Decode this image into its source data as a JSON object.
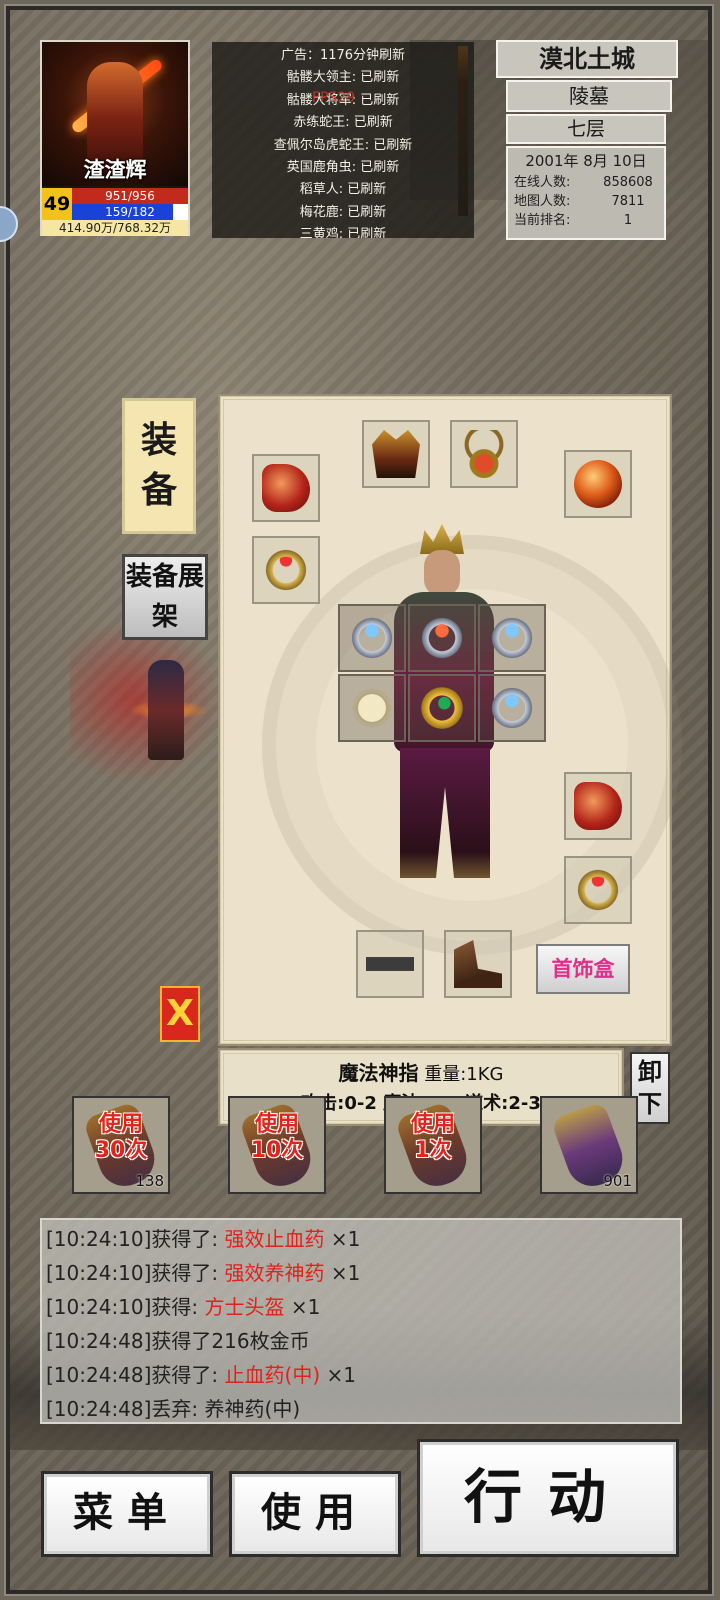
{
  "player": {
    "name": "渣渣辉",
    "level": "49",
    "hp_text": "951/956",
    "mp_text": "159/182",
    "mp_fraction": 0.874,
    "exp_text": "414.90万/768.32万"
  },
  "refresh_list": {
    "fps_overlay": "FPS29",
    "rows": [
      "广告：1176分钟刷新",
      "骷髅大领主: 已刷新",
      "骷髅大将军: 已刷新",
      "赤练蛇王: 已刷新",
      "查佩尔岛虎蛇王: 已刷新",
      "英国鹿角虫: 已刷新",
      "稻草人: 已刷新",
      "梅花鹿: 已刷新",
      "三黄鸡: 已刷新"
    ]
  },
  "location": {
    "city": "漠北土城",
    "map": "陵墓",
    "floor": "七层",
    "date": "2001年 8月 10日",
    "online_label": "在线人数:",
    "online_value": "858608",
    "map_label": "地图人数:",
    "map_value": "7811",
    "rank_label": "当前排名:",
    "rank_value": "1"
  },
  "tabs": {
    "equip_char1": "装",
    "equip_char2": "备",
    "showcase_c1": "装",
    "showcase_c2": "备",
    "showcase_c3": "展",
    "showcase_c4": "架"
  },
  "equipment": {
    "jewelry_box_label": "首饰盒",
    "close_label": "X",
    "slots": [
      {
        "slot": "left-bracelet",
        "icon": "bracelet-icon"
      },
      {
        "slot": "left-ring",
        "icon": "ring-icon"
      },
      {
        "slot": "helmet",
        "icon": "helmet-icon"
      },
      {
        "slot": "necklace",
        "icon": "necklace-icon"
      },
      {
        "slot": "medal",
        "icon": "orb-icon"
      },
      {
        "slot": "right-bracelet",
        "icon": "bracelet-icon"
      },
      {
        "slot": "right-ring",
        "icon": "ring-icon"
      },
      {
        "slot": "belt",
        "icon": "belt-icon"
      },
      {
        "slot": "boots",
        "icon": "boots-icon"
      }
    ]
  },
  "item_info": {
    "name": "魔法神指",
    "weight": "重量:1KG",
    "stats": "攻击:0-2 魔法:2-2 道术:2-3",
    "unequip_c1": "卸",
    "unequip_c2": "下"
  },
  "potions": [
    {
      "label_l1": "使用",
      "label_l2": "30次",
      "count": "138"
    },
    {
      "label_l1": "使用",
      "label_l2": "10次",
      "count": ""
    },
    {
      "label_l1": "使用",
      "label_l2": "1次",
      "count": ""
    },
    {
      "label_l1": "",
      "label_l2": "",
      "count": "901"
    }
  ],
  "log": [
    {
      "prefix": "[10:24:10]获得了: ",
      "item": "强效止血药",
      "suffix": " ×1"
    },
    {
      "prefix": "[10:24:10]获得了: ",
      "item": "强效养神药",
      "suffix": " ×1"
    },
    {
      "prefix": "[10:24:10]获得: ",
      "item": "方士头盔",
      "suffix": " ×1"
    },
    {
      "prefix": "[10:24:48]获得了216枚金币",
      "item": "",
      "suffix": ""
    },
    {
      "prefix": "[10:24:48]获得了: ",
      "item": "止血药(中)",
      "suffix": " ×1"
    },
    {
      "prefix": "[10:24:48]丢弃: 养神药(中)",
      "item": "",
      "suffix": ""
    }
  ],
  "buttons": {
    "menu": "菜单",
    "use": "使用",
    "action": "行动"
  },
  "colors": {
    "hp_bar": "#c22b1c",
    "mp_bar": "#1a41d8",
    "highlight_item": "#e0221a",
    "jewelry_text": "#e32d8a",
    "level_badge": "#f2c21b"
  }
}
